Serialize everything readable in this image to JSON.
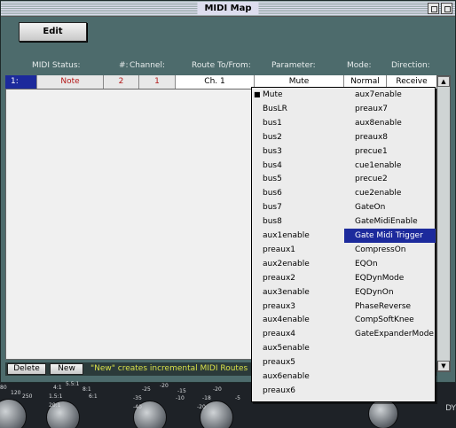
{
  "window": {
    "title": "MIDI Map"
  },
  "toolbar": {
    "edit_label": "Edit"
  },
  "columns": [
    "MIDI Status:",
    "#:",
    "Channel:",
    "Route To/From:",
    "Parameter:",
    "Mode:",
    "Direction:"
  ],
  "row": {
    "index": "1:",
    "status": "Note",
    "number": "2",
    "channel": "1",
    "route": "Ch. 1",
    "parameter": "Mute",
    "mode": "Normal",
    "direction": "Receive"
  },
  "bottom": {
    "delete_label": "Delete",
    "new_label": "New",
    "hint": "\"New\" creates incremental MIDI Routes"
  },
  "menu": {
    "checked_item": "Mute",
    "selected_item": "Gate Midi Trigger",
    "column1": [
      "Mute",
      "BusLR",
      "bus1",
      "bus2",
      "bus3",
      "bus4",
      "bus5",
      "bus6",
      "bus7",
      "bus8",
      "aux1enable",
      "preaux1",
      "aux2enable",
      "preaux2",
      "aux3enable",
      "preaux3",
      "aux4enable",
      "preaux4",
      "aux5enable",
      "preaux5",
      "aux6enable",
      "preaux6"
    ],
    "column2": [
      "aux7enable",
      "preaux7",
      "aux8enable",
      "preaux8",
      "precue1",
      "cue1enable",
      "precue2",
      "cue2enable",
      "GateOn",
      "GateMidiEnable",
      "Gate Midi Trigger",
      "CompressOn",
      "EQOn",
      "EQDynMode",
      "EQDynOn",
      "PhaseReverse",
      "CompSoftKnee",
      "GateExpanderMode"
    ]
  },
  "mixer": {
    "label": "DY",
    "knob_labels": [
      "80",
      "120",
      "250",
      "4:1",
      "5.5:1",
      "8:1",
      "6:1",
      "1.5:1",
      "20:1",
      "-25",
      "-20",
      "-15",
      "-35",
      "-40",
      "-10",
      "-20",
      "-5",
      "-18",
      "-20"
    ]
  }
}
